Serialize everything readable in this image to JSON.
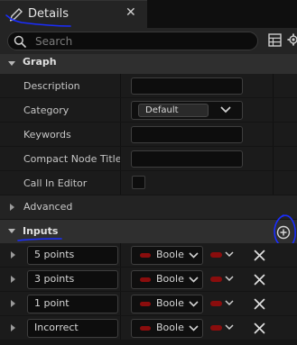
{
  "tab": {
    "title": "Details",
    "close": "✕"
  },
  "search": {
    "placeholder": "Search",
    "value": ""
  },
  "sections": {
    "graph": {
      "label": "Graph",
      "description": {
        "label": "Description",
        "value": ""
      },
      "category": {
        "label": "Category",
        "value": "Default"
      },
      "keywords": {
        "label": "Keywords",
        "value": ""
      },
      "compact_node_title": {
        "label": "Compact Node Title",
        "value": ""
      },
      "call_in_editor": {
        "label": "Call In Editor",
        "checked": false
      }
    },
    "advanced": {
      "label": "Advanced"
    },
    "inputs": {
      "label": "Inputs",
      "params": [
        {
          "name": "5 points",
          "type": "Boole"
        },
        {
          "name": "3 points",
          "type": "Boole"
        },
        {
          "name": "1 point",
          "type": "Boole"
        },
        {
          "name": "Incorrect",
          "type": "Boole"
        }
      ]
    }
  },
  "colors": {
    "bool_pin": "#8a0d0d",
    "annotation": "#1a2dff"
  },
  "icons": {
    "tab": "pencil-icon",
    "search": "search-icon",
    "grid": "grid-icon",
    "settings": "gear-icon",
    "add": "add-circle-icon",
    "remove": "close-x-icon"
  }
}
